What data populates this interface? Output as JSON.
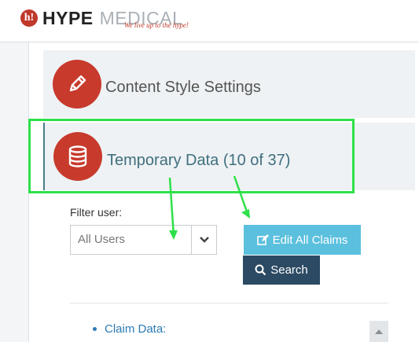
{
  "header": {
    "logo_badge": "h!",
    "logo_hype": "HYPE",
    "logo_medical": "MEDICAL",
    "logo_tagline": "We live up to the hype!"
  },
  "rail": {
    "icons": [
      "settings-icon",
      "sign-out-icon"
    ]
  },
  "sections": [
    {
      "icon": "pencil-icon",
      "title": "Content Style Settings"
    },
    {
      "icon": "database-icon",
      "title": "Temporary Data (10 of 37)"
    }
  ],
  "filter": {
    "label": "Filter user:",
    "selected": "All Users"
  },
  "buttons": {
    "edit_all": "Edit All Claims",
    "search": "Search"
  },
  "list": {
    "items": [
      "Claim Data:"
    ]
  },
  "colors": {
    "brand_red": "#c73a2c",
    "teal_title": "#3f6f7d",
    "edit_button": "#5bc0de",
    "search_button": "#2c4a63",
    "highlight": "#2ee04a",
    "link": "#2c7bb6"
  }
}
